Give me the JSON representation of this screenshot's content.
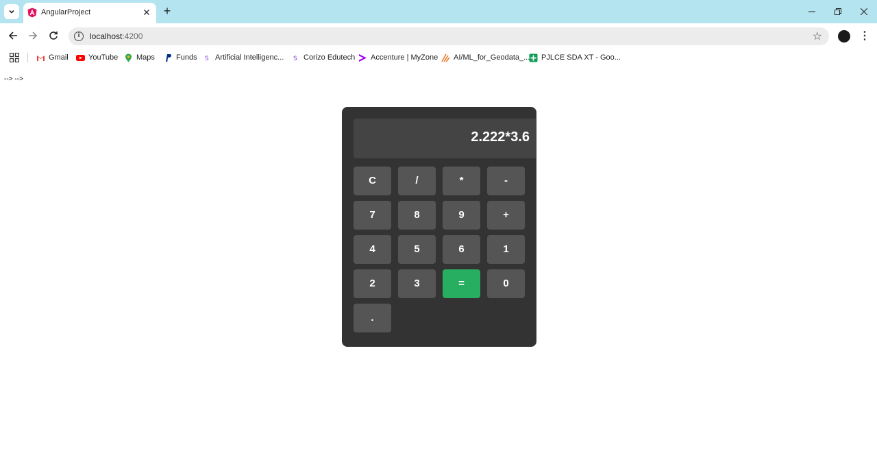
{
  "browser": {
    "tab_title": "AngularProject",
    "url_host": "localhost",
    "url_port": ":4200",
    "bookmarks": [
      {
        "label": "Gmail",
        "icon": "gmail-icon"
      },
      {
        "label": "YouTube",
        "icon": "youtube-icon"
      },
      {
        "label": "Maps",
        "icon": "maps-icon"
      },
      {
        "label": "Funds",
        "icon": "paypal-icon"
      },
      {
        "label": "Artificial Intelligenc...",
        "icon": "corizo-icon"
      },
      {
        "label": "Corizo Edutech",
        "icon": "corizo-icon"
      },
      {
        "label": "Accenture | MyZone",
        "icon": "accenture-icon"
      },
      {
        "label": "AI/ML_for_Geodata_...",
        "icon": "isro-icon"
      },
      {
        "label": "PJLCE SDA XT - Goo...",
        "icon": "sheets-icon"
      }
    ]
  },
  "page": {
    "comment_text": "--> -->"
  },
  "calculator": {
    "display": "2.222*3.6",
    "keys": [
      "C",
      "/",
      "*",
      "-",
      "7",
      "8",
      "9",
      "+",
      "4",
      "5",
      "6",
      "1",
      "2",
      "3",
      "=",
      "0",
      "."
    ],
    "equals_color": "#27ae60"
  }
}
